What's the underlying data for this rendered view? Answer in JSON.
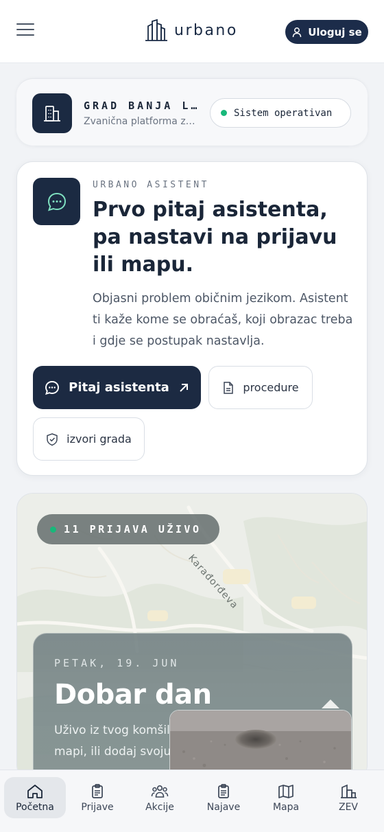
{
  "header": {
    "logo_text": "urbano",
    "login_label": "Uloguj se"
  },
  "city": {
    "name": "GRAD BANJA L…",
    "subtitle": "Zvanična platforma z…",
    "status": "Sistem operativan",
    "status_color": "#18b87a"
  },
  "assistant": {
    "kicker": "URBANO ASISTENT",
    "title": "Prvo pitaj asistenta, pa nastavi na prijavu ili mapu.",
    "description": "Objasni problem običnim jezikom. Asistent ti kaže kome se obraćaš, koji obrazac treba i gdje se postupak nastavlja.",
    "primary_button": "Pitaj asistenta",
    "procedures_button": "procedure",
    "sources_button": "izvori grada"
  },
  "map": {
    "live_label": "11 PRIJAVA UŽIVO",
    "street_label": "Karađorđeva",
    "greeting_date": "PETAK, 19. JUN",
    "greeting_title": "Dobar dan",
    "greeting_text": "Uživo iz tvog komšiluka. Pogledaj prijave na mapi, ili dodaj svoju."
  },
  "nav": {
    "items": [
      {
        "label": "Početna",
        "icon": "home-icon",
        "active": true
      },
      {
        "label": "Prijave",
        "icon": "clipboard-icon",
        "active": false
      },
      {
        "label": "Akcije",
        "icon": "people-icon",
        "active": false
      },
      {
        "label": "Najave",
        "icon": "clipboard-list-icon",
        "active": false
      },
      {
        "label": "Mapa",
        "icon": "map-icon",
        "active": false
      },
      {
        "label": "ZEV",
        "icon": "building-chart-icon",
        "active": false
      }
    ]
  },
  "colors": {
    "brand_dark": "#1c2a42",
    "accent_green": "#18b87a"
  }
}
